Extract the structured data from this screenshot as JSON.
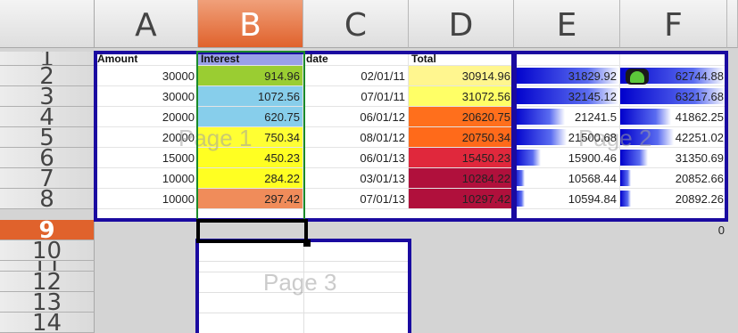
{
  "columns": [
    "A",
    "B",
    "C",
    "D",
    "E",
    "F"
  ],
  "rows": [
    "1",
    "2",
    "3",
    "4",
    "5",
    "6",
    "7",
    "8",
    "9",
    "10",
    "11",
    "12",
    "13",
    "14"
  ],
  "headers": {
    "amount": "Amount",
    "interest": "Interest",
    "date": "date",
    "total": "Total"
  },
  "data": [
    {
      "amount": "30000",
      "interest": "914.96",
      "date": "02/01/11",
      "total": "30914.96",
      "e": "31829.92",
      "f": "62744.88",
      "e_level": 1.0,
      "f_level": 0.98,
      "interest_color": "#9acd32",
      "total_color": "#fff68f"
    },
    {
      "amount": "30000",
      "interest": "1072.56",
      "date": "07/01/11",
      "total": "31072.56",
      "e": "32145.12",
      "f": "63217.68",
      "e_level": 1.0,
      "f_level": 1.0,
      "interest_color": "#87ceeb",
      "total_color": "#ffff66"
    },
    {
      "amount": "20000",
      "interest": "620.75",
      "date": "06/01/12",
      "total": "20620.75",
      "e": "21241.5",
      "f": "41862.25",
      "e_level": 0.48,
      "f_level": 0.48,
      "interest_color": "#87ceeb",
      "total_color": "#ff6f1c"
    },
    {
      "amount": "20000",
      "interest": "750.34",
      "date": "08/01/12",
      "total": "20750.34",
      "e": "21500.68",
      "f": "42251.02",
      "e_level": 0.5,
      "f_level": 0.5,
      "interest_color": "#ffff33",
      "total_color": "#ff6a1a"
    },
    {
      "amount": "15000",
      "interest": "450.23",
      "date": "06/01/13",
      "total": "15450.23",
      "e": "15900.46",
      "f": "31350.69",
      "e_level": 0.25,
      "f_level": 0.26,
      "interest_color": "#ffff22",
      "total_color": "#e0283c"
    },
    {
      "amount": "10000",
      "interest": "284.22",
      "date": "03/01/13",
      "total": "10284.22",
      "e": "10568.44",
      "f": "20852.66",
      "e_level": 0.1,
      "f_level": 0.1,
      "interest_color": "#ffff22",
      "total_color": "#b0103c"
    },
    {
      "amount": "10000",
      "interest": "297.42",
      "date": "07/01/13",
      "total": "10297.42",
      "e": "10594.84",
      "f": "20892.26",
      "e_level": 0.1,
      "f_level": 0.1,
      "interest_color": "#f08c5a",
      "total_color": "#b0103c"
    }
  ],
  "row9_f": "0",
  "pages": {
    "page1": "Page 1",
    "page2": "Page 2",
    "page3": "Page 3"
  },
  "colors": {
    "print_range": "#1a0aa0",
    "interest_frame": "#1a8a2a",
    "selection": "#e0622c",
    "cursor": "#000000"
  }
}
